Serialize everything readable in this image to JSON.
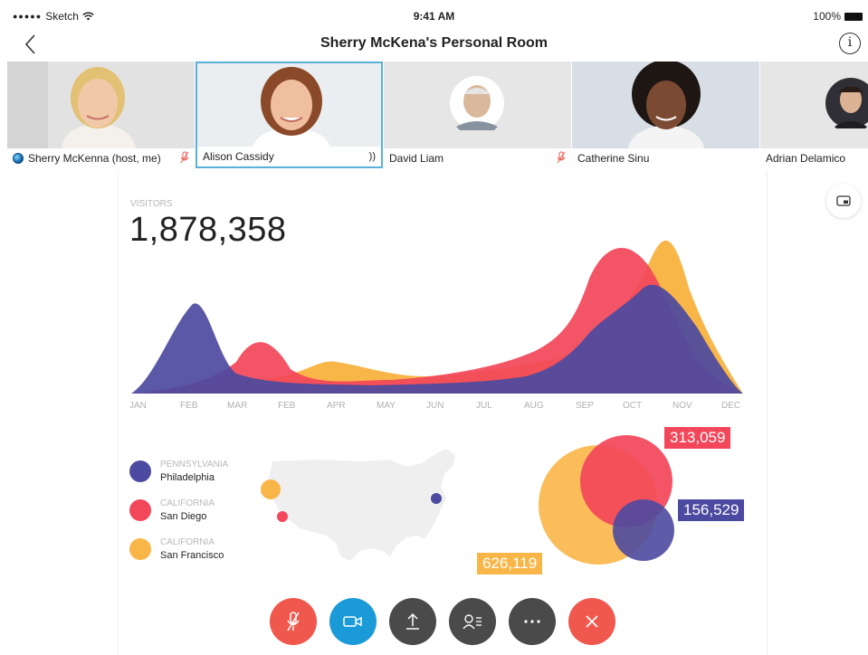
{
  "status_bar": {
    "carrier": "Sketch",
    "time": "9:41 AM",
    "battery": "100%"
  },
  "nav": {
    "title": "Sherry McKena's Personal Room"
  },
  "participants": [
    {
      "name": "Sherry McKenna (host, me)",
      "muted": true,
      "active": false
    },
    {
      "name": "Alison Cassidy",
      "speaking": true,
      "active": true
    },
    {
      "name": "David Liam",
      "muted": true,
      "active": false
    },
    {
      "name": "Catherine Sinu",
      "active": false
    },
    {
      "name": "Adrian Delamico",
      "active": false
    }
  ],
  "dashboard": {
    "visitors_label": "VISITORS",
    "visitors_value": "1,878,358",
    "months": [
      "JAN",
      "FEB",
      "MAR",
      "FEB",
      "APR",
      "MAY",
      "JUN",
      "JUL",
      "AUG",
      "SEP",
      "OCT",
      "NOV",
      "DEC"
    ],
    "legend": [
      {
        "state": "PENNSYLVANIA",
        "city": "Philadelphia",
        "color": "#4c4aa0"
      },
      {
        "state": "CALIFORNIA",
        "city": "San Diego",
        "color": "#f2475a"
      },
      {
        "state": "CALIFORNIA",
        "city": "San Francisco",
        "color": "#f9b648"
      }
    ],
    "values": {
      "san_diego": "313,059",
      "philadelphia": "156,529",
      "san_francisco": "626,119"
    }
  },
  "colors": {
    "purple": "#4c4aa0",
    "red": "#f2475a",
    "orange": "#f9b648",
    "accent": "#5ab0d8"
  },
  "controls": [
    "mute-icon",
    "video-icon",
    "share-icon",
    "participants-icon",
    "more-icon",
    "end-call-icon"
  ]
}
